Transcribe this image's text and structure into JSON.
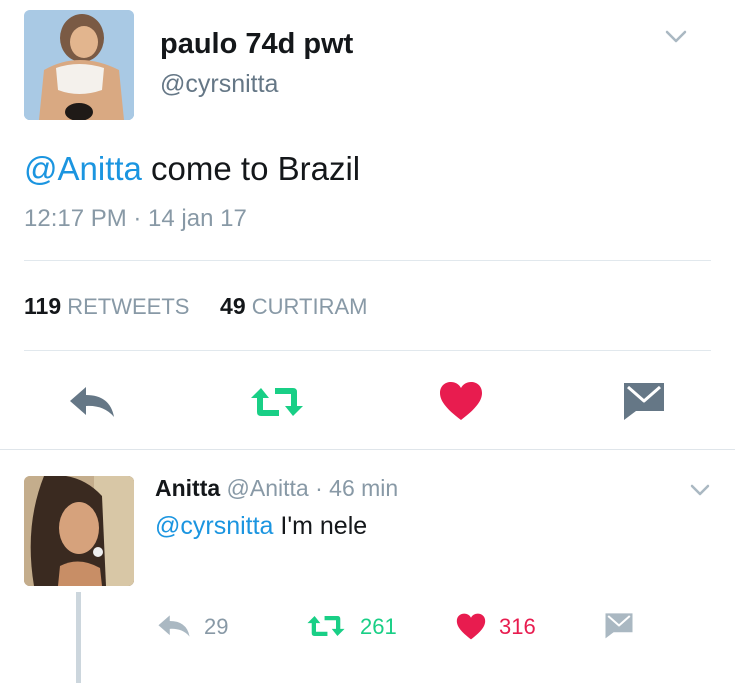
{
  "tweet": {
    "display_name": "paulo 74d pwt",
    "handle": "@cyrsnitta",
    "mention": "@Anitta",
    "text_rest": " come to Brazil",
    "timestamp": "12:17 PM · 14 jan 17",
    "stats": {
      "retweets_count": "119",
      "retweets_label": "RETWEETS",
      "likes_count": "49",
      "likes_label": "CURTIRAM"
    }
  },
  "reply": {
    "display_name": "Anitta",
    "meta": " @Anitta · 46 min",
    "mention": "@cyrsnitta",
    "text_rest": " I'm nele",
    "reply_count": "29",
    "retweet_count": "261",
    "like_count": "316"
  },
  "icons": [
    "chevron-down-icon",
    "reply-icon",
    "retweet-icon",
    "heart-icon",
    "direct-message-icon"
  ],
  "colors": {
    "mention": "#1b95e0",
    "retweet": "#19cf86",
    "like": "#e81c4f",
    "icon_gray": "#657786",
    "meta_gray": "#8899a6"
  }
}
